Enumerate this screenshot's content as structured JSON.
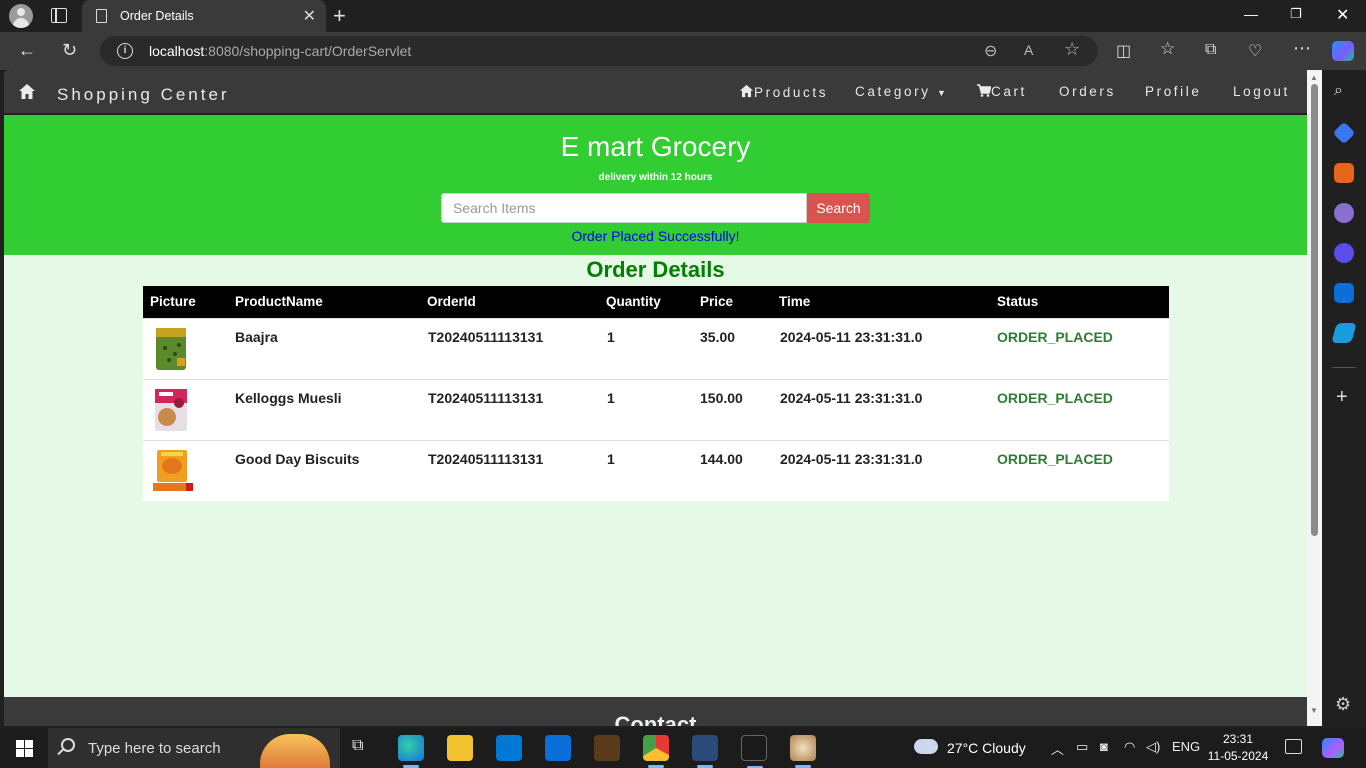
{
  "browser": {
    "tab_title": "Order Details",
    "url_host": "localhost",
    "url_path": ":8080/shopping-cart/OrderServlet"
  },
  "navbar": {
    "brand": "Shopping Center",
    "items": {
      "products": "Products",
      "category": "Category",
      "cart": "Cart",
      "orders": "Orders",
      "profile": "Profile",
      "logout": "Logout"
    }
  },
  "hero": {
    "title": "E mart Grocery",
    "subtitle": "delivery within 12 hours",
    "search_placeholder": "Search Items",
    "search_button": "Search",
    "message": "Order Placed Successfully!"
  },
  "section_title": "Order Details",
  "orders_table": {
    "columns": [
      "Picture",
      "ProductName",
      "OrderId",
      "Quantity",
      "Price",
      "Time",
      "Status"
    ],
    "rows": [
      {
        "product": "Baajra",
        "order_id": "T20240511113131",
        "quantity": "1",
        "price": "35.00",
        "time": "2024-05-11 23:31:31.0",
        "status": "ORDER_PLACED",
        "image": "baajra-pack"
      },
      {
        "product": "Kelloggs Muesli",
        "order_id": "T20240511113131",
        "quantity": "1",
        "price": "150.00",
        "time": "2024-05-11 23:31:31.0",
        "status": "ORDER_PLACED",
        "image": "muesli-pack"
      },
      {
        "product": "Good Day Biscuits",
        "order_id": "T20240511113131",
        "quantity": "1",
        "price": "144.00",
        "time": "2024-05-11 23:31:31.0",
        "status": "ORDER_PLACED",
        "image": "biscuits-pack"
      }
    ]
  },
  "footer": {
    "contact_title": "Contact"
  },
  "taskbar": {
    "search_placeholder": "Type here to search",
    "weather": "27°C  Cloudy",
    "language": "ENG",
    "time": "23:31",
    "date": "11-05-2024"
  },
  "colors": {
    "hero_green": "#32cd32",
    "page_bg": "#e6f8e6",
    "search_button": "#d9534f",
    "status_green": "#2e7d32",
    "message_blue": "#0000ee",
    "title_green": "#008000"
  }
}
